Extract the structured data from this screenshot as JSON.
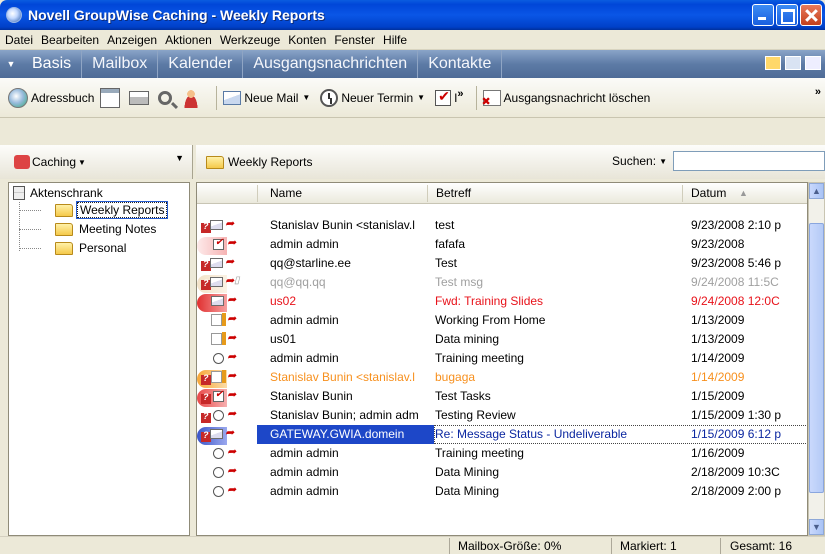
{
  "window": {
    "title": "Novell GroupWise Caching - Weekly Reports"
  },
  "menu": [
    "Datei",
    "Bearbeiten",
    "Anzeigen",
    "Aktionen",
    "Werkzeuge",
    "Konten",
    "Fenster",
    "Hilfe"
  ],
  "nav": {
    "tabs": [
      "Basis",
      "Mailbox",
      "Kalender",
      "Ausgangsnachrichten",
      "Kontakte"
    ]
  },
  "toolbar": {
    "address_book": "Adressbuch",
    "new_mail": "Neue Mail",
    "new_appointment": "Neuer Termin",
    "task_trunc": "I",
    "delete_outgoing": "Ausgangsnachricht löschen"
  },
  "left": {
    "mode": "Caching",
    "root": "Aktenschrank",
    "folders": [
      "Weekly Reports",
      "Meeting Notes",
      "Personal"
    ]
  },
  "main": {
    "folder": "Weekly Reports",
    "search_label": "Suchen:",
    "search_value": "",
    "columns": {
      "name": "Name",
      "subject": "Betreff",
      "date": "Datum"
    },
    "rows": [
      {
        "name": "Stanislav Bunin <stanislav.l",
        "subject": "test",
        "date": "9/23/2008 2:10 p"
      },
      {
        "name": "admin admin",
        "subject": "fafafa",
        "date": "9/23/2008"
      },
      {
        "name": "qq@starline.ee",
        "subject": "Test",
        "date": "9/23/2008 5:46 p"
      },
      {
        "name": "qq@qq.qq",
        "subject": "Test msg",
        "date": "9/24/2008 11:5C"
      },
      {
        "name": "us02",
        "subject": "Fwd: Training Slides",
        "date": "9/24/2008 12:0C"
      },
      {
        "name": "admin admin",
        "subject": "Working From Home",
        "date": "1/13/2009"
      },
      {
        "name": "us01",
        "subject": "Data mining",
        "date": "1/13/2009"
      },
      {
        "name": "admin admin",
        "subject": "Training meeting",
        "date": "1/14/2009"
      },
      {
        "name": "Stanislav Bunin <stanislav.l",
        "subject": "bugaga",
        "date": "1/14/2009"
      },
      {
        "name": "Stanislav Bunin",
        "subject": "Test Tasks",
        "date": "1/15/2009"
      },
      {
        "name": "Stanislav Bunin; admin adm",
        "subject": "Testing Review",
        "date": "1/15/2009 1:30 p"
      },
      {
        "name": "GATEWAY.GWIA.domein",
        "subject": "Re: Message Status - Undeliverable",
        "date": "1/15/2009 6:12 p"
      },
      {
        "name": "admin admin",
        "subject": "Training meeting",
        "date": "1/16/2009"
      },
      {
        "name": "admin admin",
        "subject": "Data Mining",
        "date": "2/18/2009 10:3C"
      },
      {
        "name": "admin admin",
        "subject": "Data Mining",
        "date": "2/18/2009 2:00 p"
      }
    ]
  },
  "status": {
    "mailbox_size": "Mailbox-Größe: 0%",
    "selected": "Markiert: 1",
    "total": "Gesamt: 16"
  },
  "colors": {
    "title_blue": "#0a56e6",
    "selection": "#1d47c8",
    "unread_red": "#e8121a",
    "orange": "#f7901e",
    "muted": "#a0a0a0"
  }
}
